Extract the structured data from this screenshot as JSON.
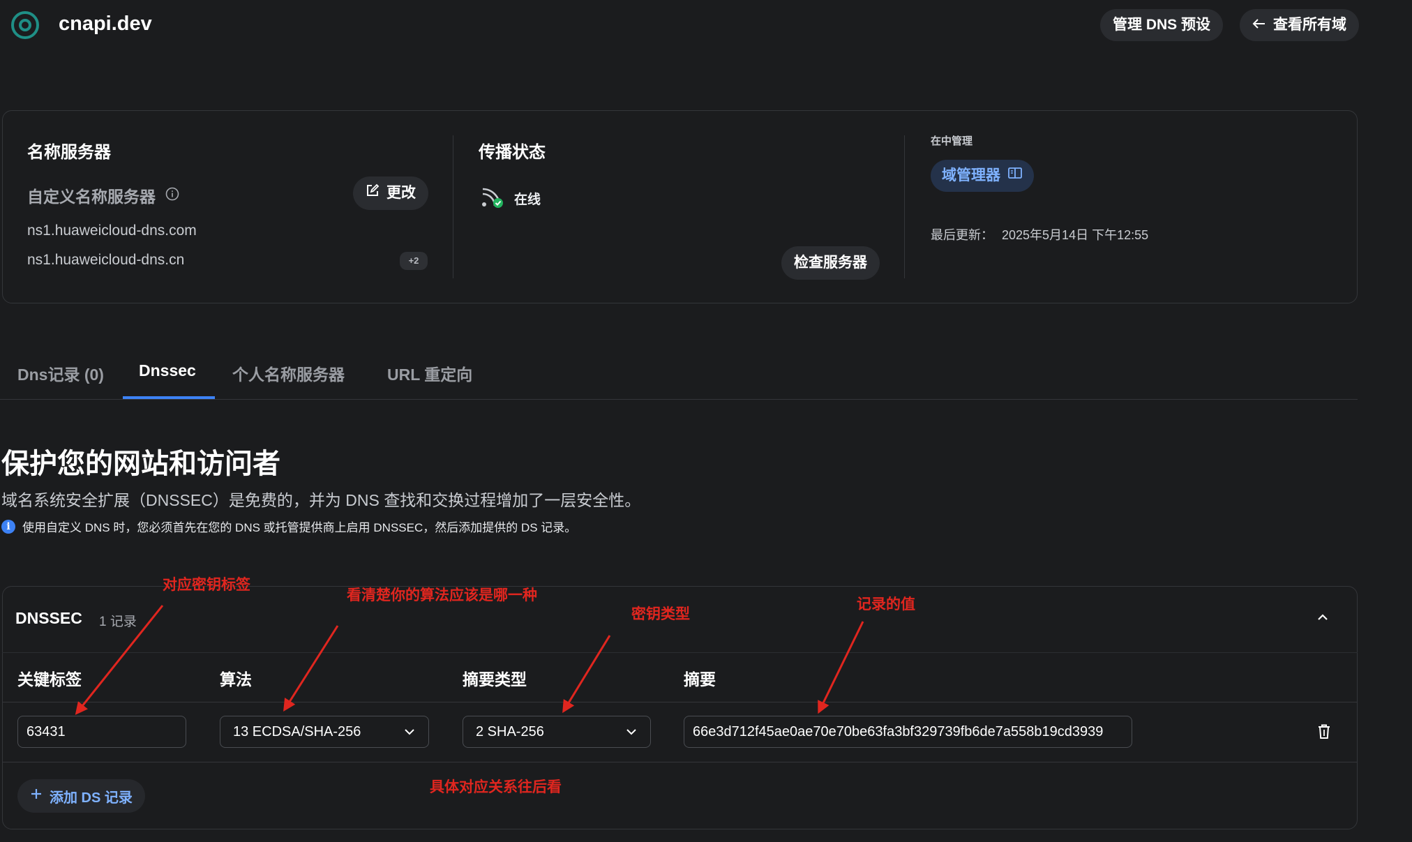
{
  "header": {
    "domain": "cnapi.dev",
    "manage_dns_preset": "管理 DNS 预设",
    "view_all_domains": "查看所有域"
  },
  "nameservers": {
    "title": "名称服务器",
    "custom_label": "自定义名称服务器",
    "change_button": "更改",
    "entries": [
      "ns1.huaweicloud-dns.com",
      "ns1.huaweicloud-dns.cn"
    ],
    "more_badge": "+2"
  },
  "propagation": {
    "title": "传播状态",
    "status": "在线",
    "check_button": "检查服务器"
  },
  "managed_in": {
    "label": "在中管理",
    "manager_button": "域管理器",
    "last_updated_label": "最后更新：",
    "last_updated_value": "2025年5月14日 下午12:55"
  },
  "tabs": [
    {
      "label": "Dns记录 (0)",
      "active": false
    },
    {
      "label": "Dnssec",
      "active": true
    },
    {
      "label": "个人名称服务器",
      "active": false
    },
    {
      "label": "URL 重定向",
      "active": false
    }
  ],
  "protect": {
    "heading": "保护您的网站和访问者",
    "description": "域名系统安全扩展（DNSSEC）是免费的，并为 DNS 查找和交换过程增加了一层安全性。",
    "note": "使用自定义 DNS 时，您必须首先在您的 DNS 或托管提供商上启用 DNSSEC，然后添加提供的 DS 记录。"
  },
  "dnssec": {
    "title": "DNSSEC",
    "count": "1 记录",
    "columns": [
      "关键标签",
      "算法",
      "摘要类型",
      "摘要"
    ],
    "record": {
      "key_tag": "63431",
      "algorithm": "13 ECDSA/SHA-256",
      "digest_type": "2 SHA-256",
      "digest": "66e3d712f45ae0ae70e70be63fa3bf329739fb6de7a558b19cd3939"
    },
    "add_button": "添加 DS 记录"
  },
  "annotations": {
    "key_tag": "对应密钥标签",
    "algorithm": "看清楚你的算法应该是哪一种",
    "key_type": "密钥类型",
    "record_value": "记录的值",
    "mapping_note": "具体对应关系往后看"
  },
  "colors": {
    "background": "#1b1c1e",
    "accent_blue": "#3d82f5",
    "online_green": "#22b35e",
    "annotation_red": "#e0261f"
  }
}
